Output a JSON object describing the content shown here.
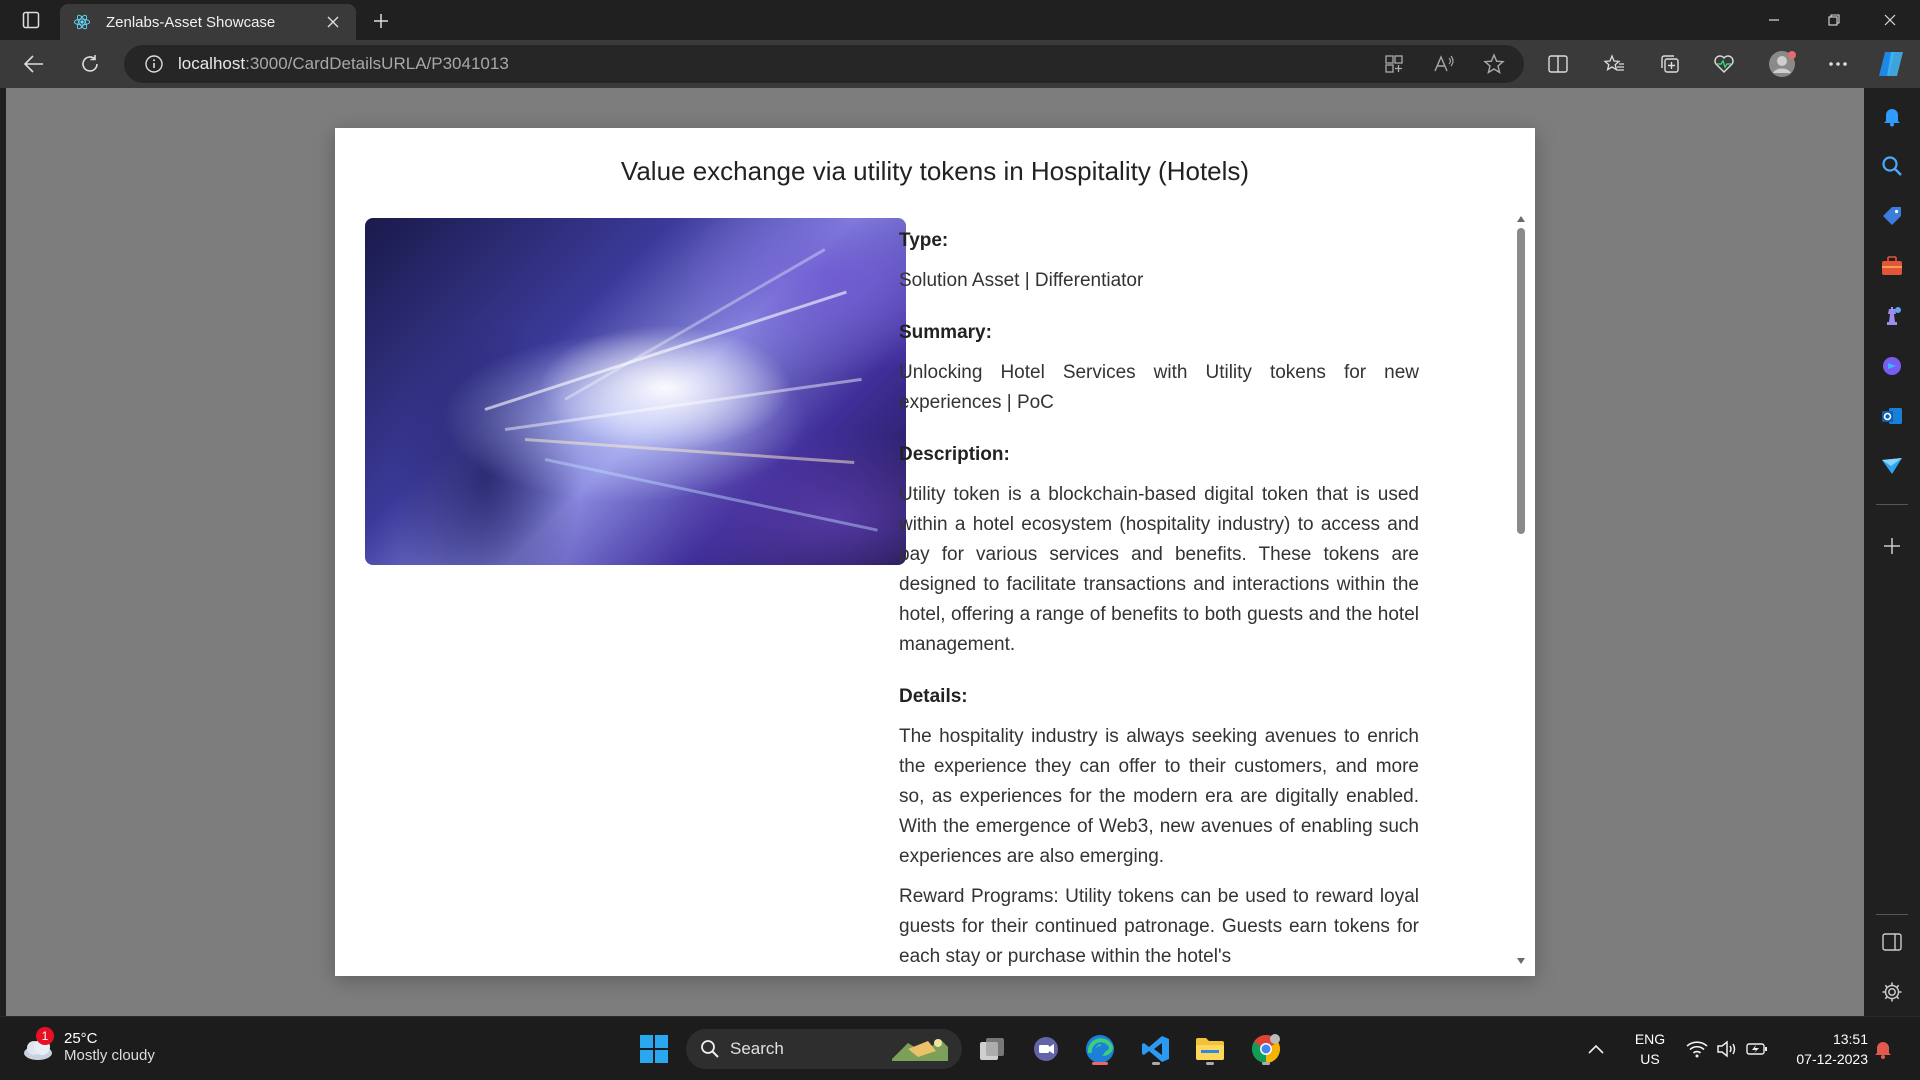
{
  "browser": {
    "tab_title": "Zenlabs-Asset Showcase",
    "url_host": "localhost",
    "url_path": ":3000/CardDetailsURLA/P3041013"
  },
  "modal": {
    "title": "Value exchange via utility tokens in Hospitality (Hotels)",
    "sections": {
      "type_label": "Type:",
      "type_text": "Solution Asset | Differentiator",
      "summary_label": "Summary:",
      "summary_text": "Unlocking Hotel Services with Utility tokens for new experiences | PoC",
      "description_label": "Description:",
      "description_text": "Utility token is a blockchain-based digital token that is used within a hotel ecosystem (hospitality industry) to access and pay for various services and benefits. These tokens are designed to facilitate transactions and interactions within the hotel, offering a range of benefits to both guests and the hotel management.",
      "details_label": "Details:",
      "details_text_1": "The hospitality industry is always seeking avenues to enrich the experience they can offer to their customers, and more so, as experiences for the modern era are digitally enabled. With the emergence of Web3, new avenues of enabling such experiences are also emerging.",
      "details_text_2": "Reward Programs: Utility tokens can be used to reward loyal guests for their continued patronage. Guests earn tokens for each stay or purchase within the hotel's"
    }
  },
  "taskbar": {
    "weather_temp": "25°C",
    "weather_condition": "Mostly cloudy",
    "weather_badge": "1",
    "search_label": "Search",
    "lang_line1": "ENG",
    "lang_line2": "US",
    "time": "13:51",
    "date": "07-12-2023"
  },
  "colors": {
    "accent_blue": "#0078d4",
    "edge_green": "#3ccf7a",
    "notification_red": "#e81123"
  }
}
